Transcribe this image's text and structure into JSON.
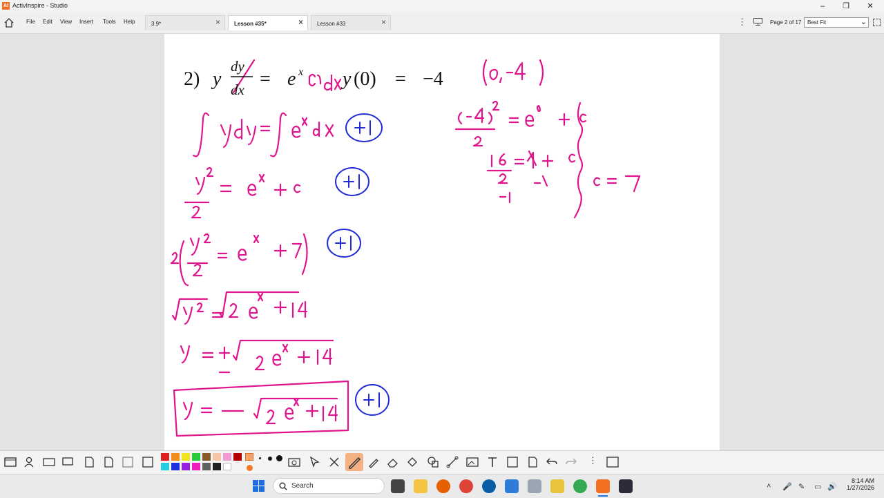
{
  "window": {
    "title": "ActivInspire - Studio"
  },
  "menu": [
    "File",
    "Edit",
    "View",
    "Insert",
    "Tools",
    "Help"
  ],
  "tabs": [
    {
      "label": "3.9*",
      "active": false
    },
    {
      "label": "Lesson #35*",
      "active": true
    },
    {
      "label": "Lesson #33",
      "active": false
    }
  ],
  "page_indicator": "Page 2 of 17",
  "zoom": {
    "value": "Best Fit"
  },
  "flipchart": {
    "problem_label": "2)",
    "problem_typed": "y dy/dx = e^x  y(0) = −4",
    "handwriting": [
      "(0,−4)",
      "∫y dy = ∫e^x dx",
      "y²/2 = e^x + c",
      "2(y²/2 = e^x + 7)",
      "√y² = √(2e^x + 14)",
      "y = ±√(2e^x + 14)",
      "y = −√(2e^x + 14)",
      "(−4)²/2 = e^0 + c",
      "16/2 = 1 + c",
      "c = 7",
      "+1"
    ],
    "ink_color": "#e0148c",
    "score_circle_color": "#1f2bd6"
  },
  "colors": {
    "palette": [
      "#e02020",
      "#f28c1c",
      "#f2e31c",
      "#2ac93a",
      "#8b5a2b",
      "#f4c6a6",
      "#f29ad2",
      "#b30000",
      "#20d0e0",
      "#2030e0",
      "#9a20e0",
      "#f01cc0",
      "#606060",
      "#202020",
      "#ffffff"
    ]
  },
  "taskbar": {
    "search_placeholder": "Search",
    "time": "8:14 AM",
    "date": "1/27/2026"
  }
}
